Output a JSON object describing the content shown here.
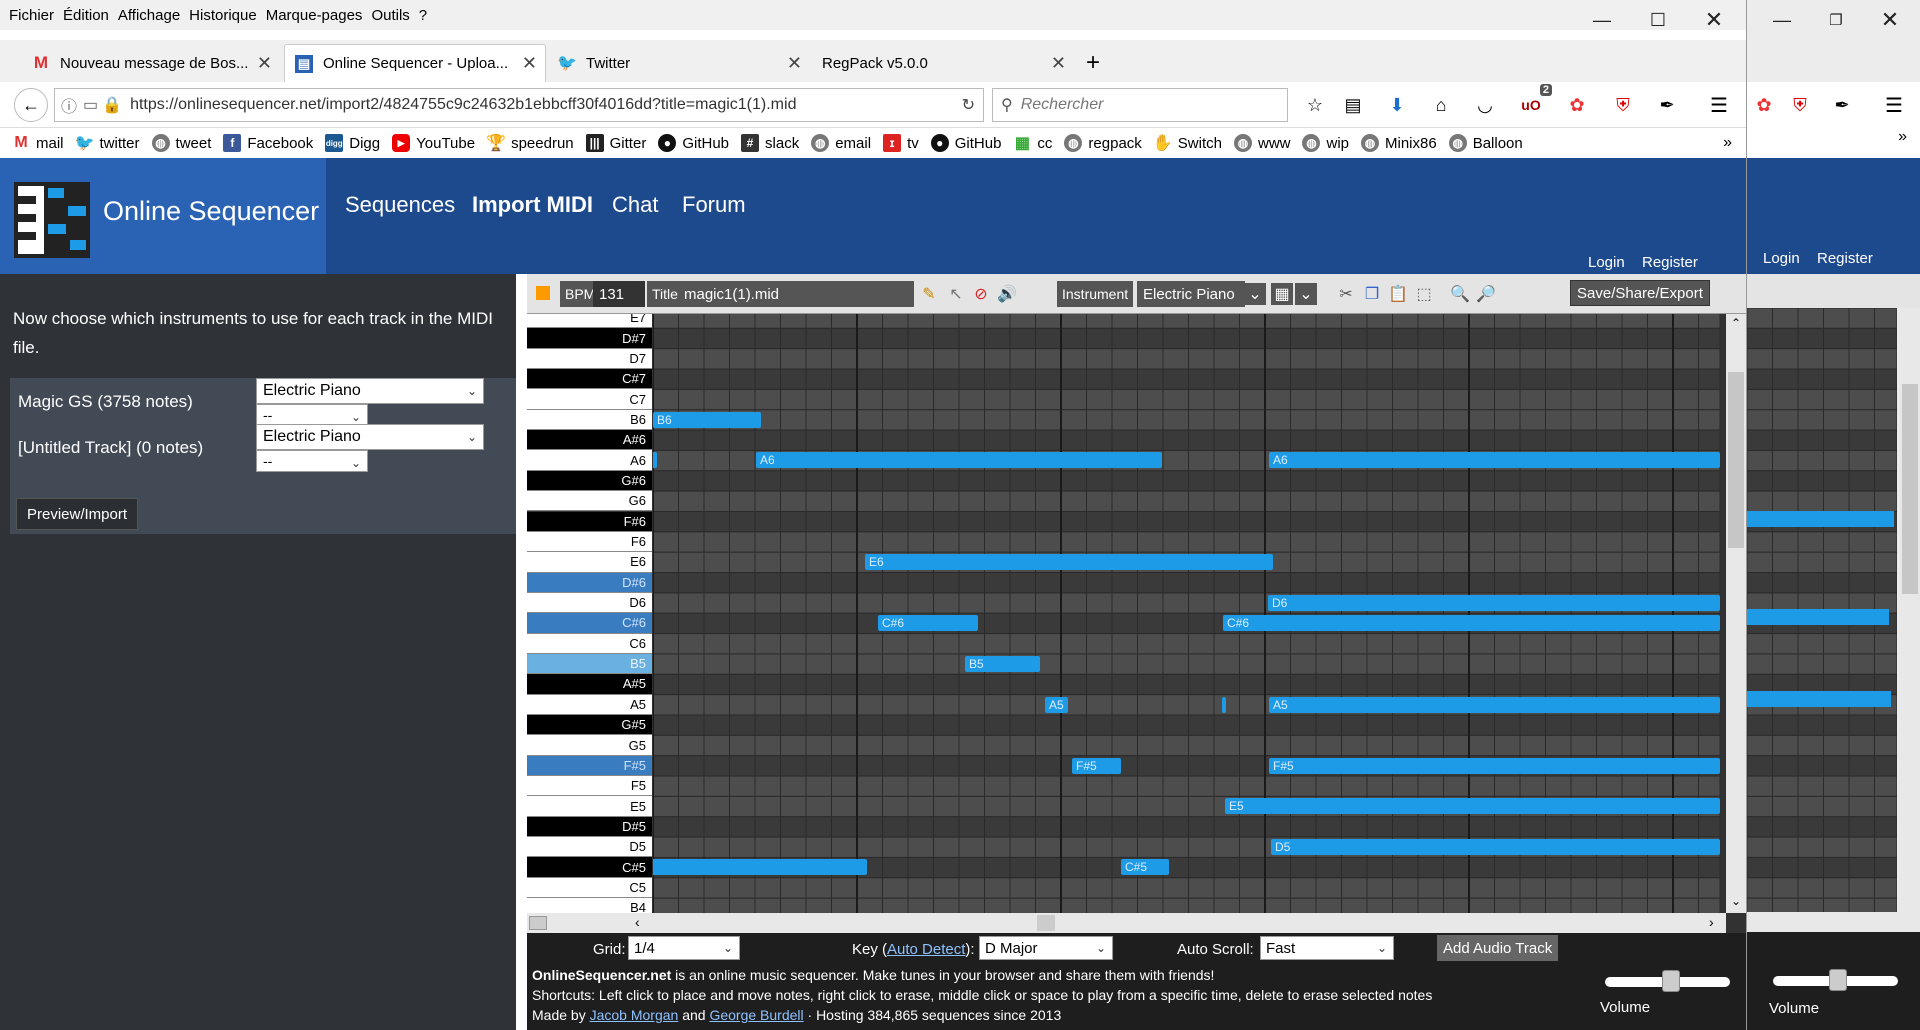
{
  "menu": [
    "Fichier",
    "Édition",
    "Affichage",
    "Historique",
    "Marque-pages",
    "Outils",
    "?"
  ],
  "tabs": [
    {
      "label": "Nouveau message de Bos...",
      "icon": "gmail-icon"
    },
    {
      "label": "Online Sequencer - Uploa...",
      "icon": "sequencer-icon"
    },
    {
      "label": "Twitter",
      "icon": "twitter-icon"
    },
    {
      "label": "RegPack v5.0.0",
      "icon": ""
    }
  ],
  "url": "https://onlinesequencer.net/import2/4824755c9c24632b1ebbcff30f4016dd?title=magic1(1).mid",
  "search_placeholder": "Rechercher",
  "badge_count": "2",
  "bookmarks": [
    "mail",
    "twitter",
    "tweet",
    "Facebook",
    "Digg",
    "YouTube",
    "speedrun",
    "Gitter",
    "GitHub",
    "slack",
    "email",
    "tv",
    "GitHub",
    "cc",
    "regpack",
    "Switch",
    "www",
    "wip",
    "Minix86",
    "Balloon"
  ],
  "site": {
    "title": "Online Sequencer",
    "nav": [
      "Sequences",
      "Import MIDI",
      "Chat",
      "Forum"
    ],
    "login": "Login",
    "register": "Register"
  },
  "import_panel": {
    "instructions": "Now choose which instruments to use for each track in the MIDI file.",
    "tracks": [
      {
        "name": "Magic GS (3758 notes)",
        "instrument": "Electric Piano",
        "sub": "--"
      },
      {
        "name": "[Untitled Track] (0 notes)",
        "instrument": "Electric Piano",
        "sub": "--"
      }
    ],
    "preview_button": "Preview/Import"
  },
  "toolbar": {
    "bpm_label": "BPM",
    "bpm": "131",
    "title_label": "Title",
    "title": "magic1(1).mid",
    "instrument_label": "Instrument",
    "instrument": "Electric Piano",
    "save_button": "Save/Share/Export"
  },
  "piano_keys": [
    "E7",
    "D#7",
    "D7",
    "C#7",
    "C7",
    "B6",
    "A#6",
    "A6",
    "G#6",
    "G6",
    "F#6",
    "F6",
    "E6",
    "D#6",
    "D6",
    "C#6",
    "C6",
    "B5",
    "A#5",
    "A5",
    "G#5",
    "G5",
    "F#5",
    "F5",
    "E5",
    "D#5",
    "D5",
    "C#5",
    "C5",
    "B4"
  ],
  "notes": [
    {
      "label": "B6"
    },
    {
      "label": ""
    },
    {
      "label": "A6"
    },
    {
      "label": "A6"
    },
    {
      "label": "E6"
    },
    {
      "label": "D6"
    },
    {
      "label": "C#6"
    },
    {
      "label": "C#6"
    },
    {
      "label": "B5"
    },
    {
      "label": "A5"
    },
    {
      "label": ""
    },
    {
      "label": "A5"
    },
    {
      "label": "F#5"
    },
    {
      "label": "F#5"
    },
    {
      "label": "E5"
    },
    {
      "label": "D5"
    },
    {
      "label": ""
    },
    {
      "label": "C#5"
    }
  ],
  "bottom": {
    "grid_label": "Grid:",
    "grid_value": "1/4",
    "key_label": "Key (",
    "key_link": "Auto Detect",
    "key_close": "):",
    "key_value": "D Major",
    "autoscroll_label": "Auto Scroll:",
    "autoscroll_value": "Fast",
    "add_audio": "Add Audio Track",
    "info1_bold": "OnlineSequencer.net",
    "info1": " is an online music sequencer. Make tunes in your browser and share them with friends!",
    "info2": "Shortcuts: Left click to place and move notes, right click to erase, middle click or space to play from a specific time, delete to erase selected notes",
    "info3a": "Made by ",
    "author1": "Jacob Morgan",
    "info3b": " and ",
    "author2": "George Burdell",
    "info3c": " · Hosting 384,865 sequences since 2013",
    "volume_label": "Volume"
  },
  "second_window": {
    "login": "Login",
    "register": "Register",
    "volume_label": "Volume"
  }
}
